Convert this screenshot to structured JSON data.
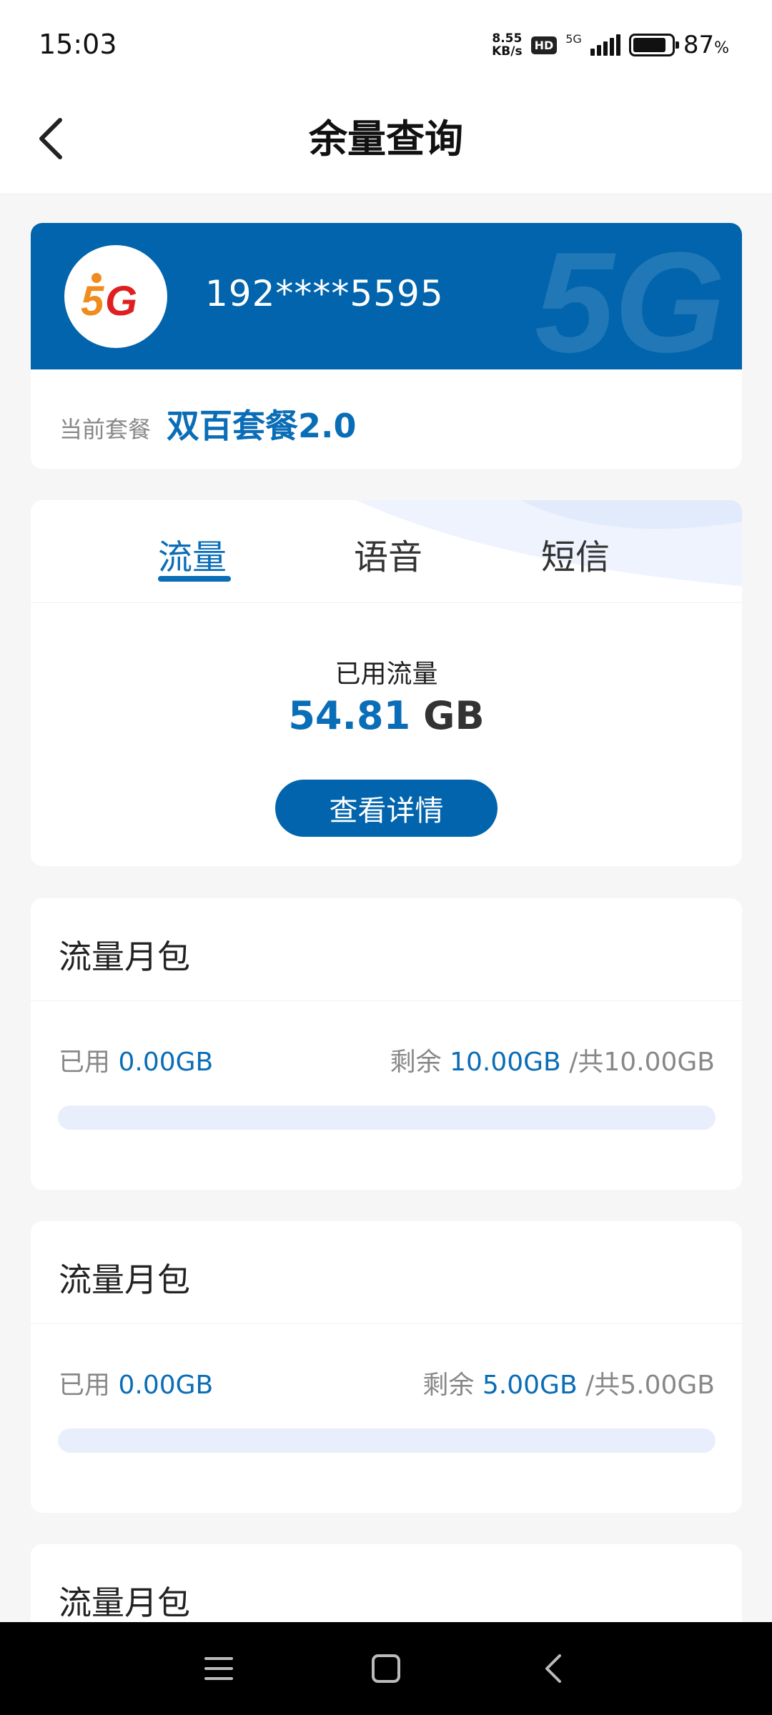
{
  "status_bar": {
    "time": "15:03",
    "net_speed_value": "8.55",
    "net_speed_unit": "KB/s",
    "hd_badge": "HD",
    "network_type": "5G",
    "battery_percent": "87",
    "battery_percent_symbol": "%"
  },
  "header": {
    "title": "余量查询",
    "back_icon": "chevron-left-icon"
  },
  "account": {
    "logo_text": "5G",
    "phone": "192****5595",
    "plan_label": "当前套餐",
    "plan_name": "双百套餐2.0",
    "banner_color": "#0164ac"
  },
  "usage": {
    "tabs": [
      "流量",
      "语音",
      "短信"
    ],
    "active_tab": "流量",
    "used_label": "已用流量",
    "used_value": "54.81",
    "used_unit": "GB",
    "detail_button": "查看详情"
  },
  "packages": [
    {
      "title": "流量月包",
      "used_label": "已用",
      "used_value": "0.00GB",
      "remain_label": "剩余",
      "remain_value": "10.00GB",
      "separator": "/",
      "total_label": "共10.00GB",
      "used_fraction": 0
    },
    {
      "title": "流量月包",
      "used_label": "已用",
      "used_value": "0.00GB",
      "remain_label": "剩余",
      "remain_value": "5.00GB",
      "separator": "/",
      "total_label": "共5.00GB",
      "used_fraction": 0
    },
    {
      "title": "流量月包"
    }
  ],
  "colors": {
    "accent": "#0a6db7",
    "button": "#0164ac",
    "progress_track": "#e8eefb",
    "background": "#f6f6f6"
  },
  "nav_bar": {
    "icons": [
      "menu-icon",
      "home-icon",
      "back-icon"
    ]
  }
}
